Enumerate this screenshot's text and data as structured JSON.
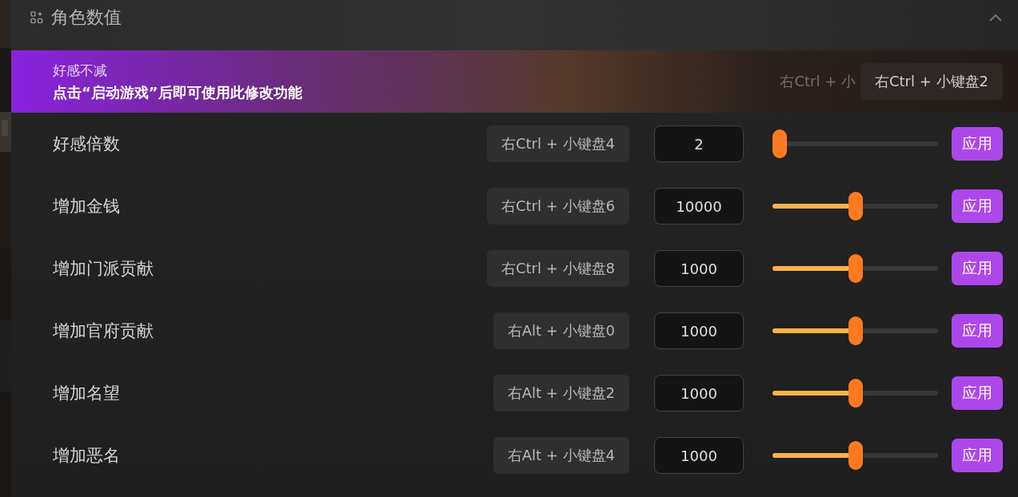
{
  "section": {
    "title": "角色数值",
    "expanded": true
  },
  "banner": {
    "title": "好感不减",
    "note": "点击“启动游戏”后即可使用此修改功能",
    "ghost_hotkey": "右Ctrl + 小",
    "hotkey": "右Ctrl + 小键盘2"
  },
  "rows": [
    {
      "label": "好感倍数",
      "hotkey": "右Ctrl + 小键盘4",
      "value": "2",
      "level": 0,
      "button": "应用"
    },
    {
      "label": "增加金钱",
      "hotkey": "右Ctrl + 小键盘6",
      "value": "10000",
      "level": 0.5,
      "button": "应用"
    },
    {
      "label": "增加门派贡献",
      "hotkey": "右Ctrl + 小键盘8",
      "value": "1000",
      "level": 0.5,
      "button": "应用"
    },
    {
      "label": "增加官府贡献",
      "hotkey": "右Alt + 小键盘0",
      "value": "1000",
      "level": 0.5,
      "button": "应用"
    },
    {
      "label": "增加名望",
      "hotkey": "右Alt + 小键盘2",
      "value": "1000",
      "level": 0.5,
      "button": "应用"
    },
    {
      "label": "增加恶名",
      "hotkey": "右Alt + 小键盘4",
      "value": "1000",
      "level": 0.5,
      "button": "应用"
    }
  ]
}
